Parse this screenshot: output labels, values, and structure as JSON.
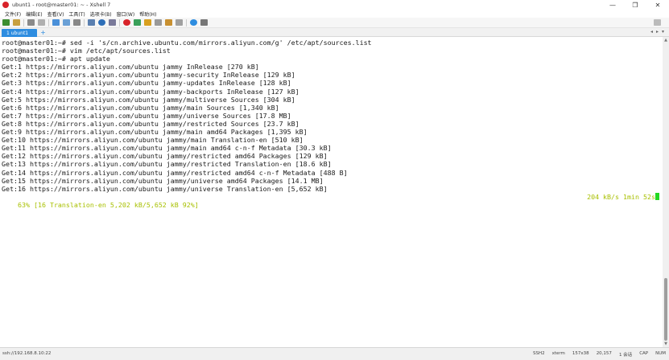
{
  "window": {
    "title": "ubunt1 - root@master01: ~ - Xshell 7",
    "minimize_glyph": "—",
    "maximize_glyph": "❐",
    "close_glyph": "✕"
  },
  "menu": [
    "文件(F)",
    "编辑(E)",
    "查看(V)",
    "工具(T)",
    "选项卡(B)",
    "窗口(W)",
    "帮助(H)"
  ],
  "tabs": [
    {
      "label": "1 ubunt1",
      "active": true
    }
  ],
  "tab_add_label": "+",
  "tab_nav": [
    "◂",
    "▸",
    "▾"
  ],
  "terminal": {
    "lines": [
      "root@master01:~# sed -i 's/cn.archive.ubuntu.com/mirrors.aliyun.com/g' /etc/apt/sources.list",
      "root@master01:~# vim /etc/apt/sources.list",
      "root@master01:~# apt update",
      "Get:1 https://mirrors.aliyun.com/ubuntu jammy InRelease [270 kB]",
      "Get:2 https://mirrors.aliyun.com/ubuntu jammy-security InRelease [129 kB]",
      "Get:3 https://mirrors.aliyun.com/ubuntu jammy-updates InRelease [128 kB]",
      "Get:4 https://mirrors.aliyun.com/ubuntu jammy-backports InRelease [127 kB]",
      "Get:5 https://mirrors.aliyun.com/ubuntu jammy/multiverse Sources [304 kB]",
      "Get:6 https://mirrors.aliyun.com/ubuntu jammy/main Sources [1,340 kB]",
      "Get:7 https://mirrors.aliyun.com/ubuntu jammy/universe Sources [17.8 MB]",
      "Get:8 https://mirrors.aliyun.com/ubuntu jammy/restricted Sources [23.7 kB]",
      "Get:9 https://mirrors.aliyun.com/ubuntu jammy/main amd64 Packages [1,395 kB]",
      "Get:10 https://mirrors.aliyun.com/ubuntu jammy/main Translation-en [510 kB]",
      "Get:11 https://mirrors.aliyun.com/ubuntu jammy/main amd64 c-n-f Metadata [30.3 kB]",
      "Get:12 https://mirrors.aliyun.com/ubuntu jammy/restricted amd64 Packages [129 kB]",
      "Get:13 https://mirrors.aliyun.com/ubuntu jammy/restricted Translation-en [18.6 kB]",
      "Get:14 https://mirrors.aliyun.com/ubuntu jammy/restricted amd64 c-n-f Metadata [488 B]",
      "Get:15 https://mirrors.aliyun.com/ubuntu jammy/universe amd64 Packages [14.1 MB]",
      "Get:16 https://mirrors.aliyun.com/ubuntu jammy/universe Translation-en [5,652 kB]"
    ],
    "progress_left": "63% [16 Translation-en 5,202 kB/5,652 kB 92%]",
    "progress_right": "204 kB/s 1min 52s",
    "progress_color": "#a8c000",
    "cursor_color": "#22d822"
  },
  "scroll": {
    "up_glyph": "▲",
    "down_glyph": "▼"
  },
  "statusbar": {
    "connection": "ssh://192.168.8.10:22",
    "protocol": "SSH2",
    "terminal_type": "xterm",
    "size": "157x38",
    "cursor_pos": "20,157",
    "sessions": "1 会话",
    "caps": "CAP",
    "num": "NUM"
  },
  "colors": {
    "accent": "#2e8de0",
    "close_icon": "#d8232a"
  }
}
